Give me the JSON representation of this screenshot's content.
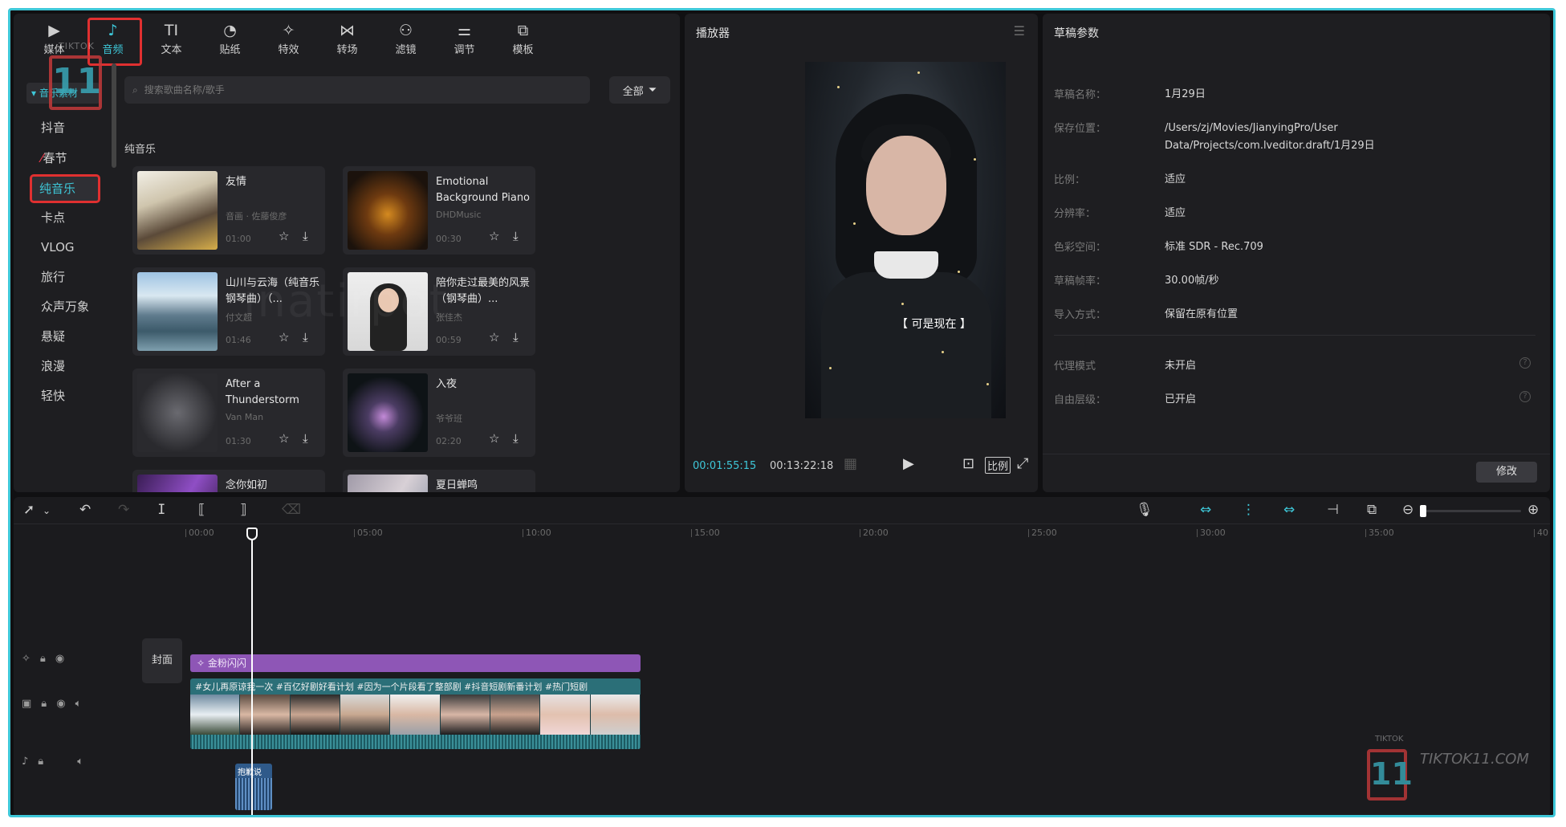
{
  "toolbar": {
    "items": [
      {
        "label": "媒体",
        "icon": "media-icon",
        "glyph": "▶"
      },
      {
        "label": "音频",
        "icon": "audio-icon",
        "glyph": "♪"
      },
      {
        "label": "文本",
        "icon": "text-icon",
        "glyph": "TI"
      },
      {
        "label": "贴纸",
        "icon": "sticker-icon",
        "glyph": "◔"
      },
      {
        "label": "特效",
        "icon": "effects-icon",
        "glyph": "✧"
      },
      {
        "label": "转场",
        "icon": "transition-icon",
        "glyph": "⋈"
      },
      {
        "label": "滤镜",
        "icon": "filter-icon",
        "glyph": "⚇"
      },
      {
        "label": "调节",
        "icon": "adjust-icon",
        "glyph": "⚌"
      },
      {
        "label": "模板",
        "icon": "template-icon",
        "glyph": "⧉"
      }
    ],
    "active_index": 1
  },
  "sidebar": {
    "group_label": "▾ 音乐素材",
    "items": [
      "抖音",
      "春节",
      "纯音乐",
      "卡点",
      "VLOG",
      "旅行",
      "众声万象",
      "悬疑",
      "浪漫",
      "轻快"
    ],
    "selected": "纯音乐"
  },
  "search": {
    "placeholder": "搜索歌曲名称/歌手"
  },
  "filter": {
    "label": "全部"
  },
  "section_title": "纯音乐",
  "music": [
    {
      "title": "友情",
      "artist": "音画 · 佐藤俊彦",
      "duration": "01:00"
    },
    {
      "title": "Emotional Background Piano",
      "artist": "DHDMusic",
      "duration": "00:30"
    },
    {
      "title": "山川与云海（纯音乐钢琴曲）（...",
      "artist": "付文超",
      "duration": "01:46"
    },
    {
      "title": "陪你走过最美的风景（钢琴曲）...",
      "artist": "张佳杰",
      "duration": "00:59"
    },
    {
      "title": "After a Thunderstorm",
      "artist": "Van Man",
      "duration": "01:30"
    },
    {
      "title": "入夜",
      "artist": "爷爷班",
      "duration": "02:20"
    },
    {
      "title": "念你如初",
      "artist": "",
      "duration": ""
    },
    {
      "title": "夏日蝉鸣",
      "artist": "",
      "duration": ""
    }
  ],
  "player": {
    "title": "播放器",
    "caption": "【 可是现在 】",
    "current_time": "00:01:55:15",
    "total_time": "00:13:22:18",
    "ratio_label": "比例"
  },
  "params": {
    "title": "草稿参数",
    "rows": [
      {
        "key": "草稿名称：",
        "value": "1月29日"
      },
      {
        "key": "保存位置：",
        "value": "/Users/zj/Movies/JianyingPro/User Data/Projects/com.lveditor.draft/1月29日"
      },
      {
        "key": "比例：",
        "value": "适应"
      },
      {
        "key": "分辨率：",
        "value": "适应"
      },
      {
        "key": "色彩空间：",
        "value": "标准 SDR - Rec.709"
      },
      {
        "key": "草稿帧率：",
        "value": "30.00帧/秒"
      },
      {
        "key": "导入方式：",
        "value": "保留在原有位置"
      },
      {
        "key": "代理模式",
        "value": "未开启"
      },
      {
        "key": "自由层级：",
        "value": "已开启"
      }
    ],
    "edit_label": "修改"
  },
  "timeline": {
    "ruler": [
      "00:00",
      "05:00",
      "10:00",
      "15:00",
      "20:00",
      "25:00",
      "30:00",
      "35:00",
      "40"
    ],
    "zoom_fraction": 0.02,
    "cover_label": "封面",
    "effect_clip_label": "金粉闪闪",
    "video_clip_label": "#女儿再原谅我一次 #百亿好剧好看计划 #因为一个片段看了整部剧 #抖音短剧新番计划 #热门短剧",
    "audio_clip_label": "抱歉说"
  },
  "watermarks": {
    "logo_text": "11",
    "site_text": "TIKTOK11.COM",
    "small_text": "TIKTOK",
    "center_text": "inatirpot"
  },
  "colors": {
    "accent": "#3ec7d8",
    "highlight_box": "#e03030",
    "effect_clip": "#8e56b6",
    "video_clip": "#2b6f78",
    "audio_clip": "#2f5a8a"
  }
}
